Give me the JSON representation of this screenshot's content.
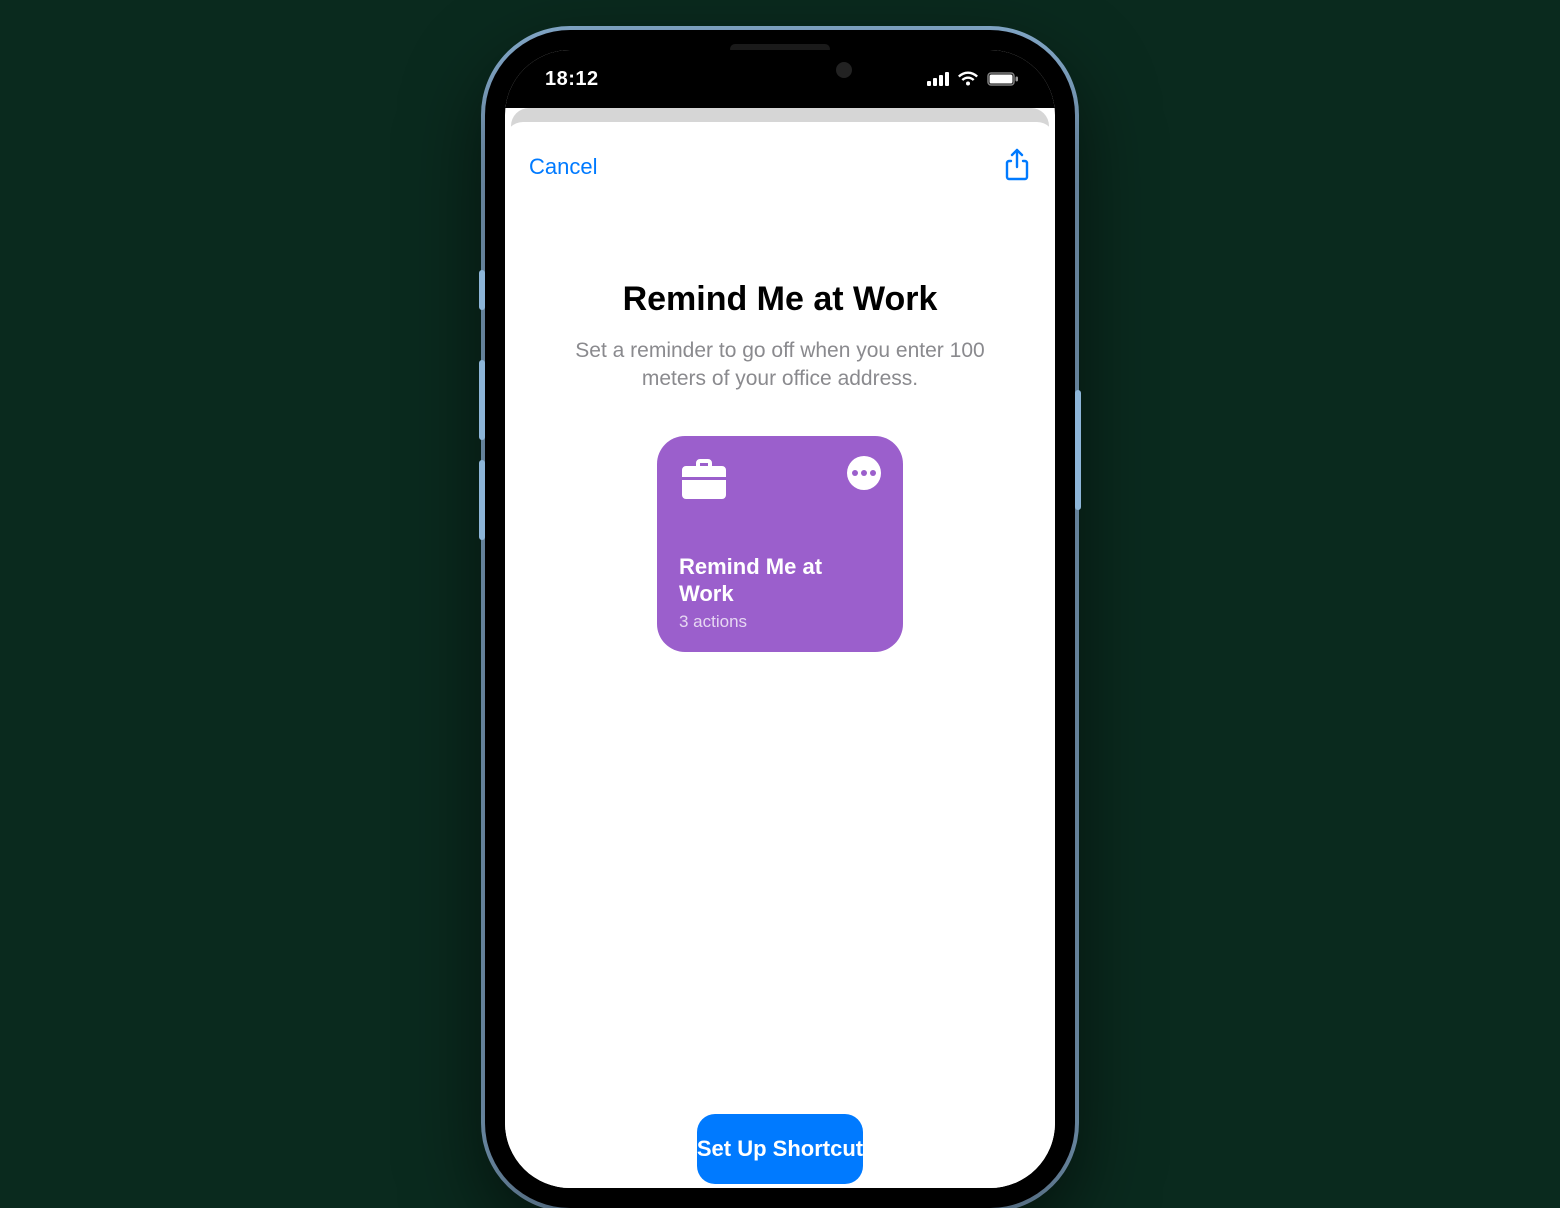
{
  "status": {
    "time": "18:12"
  },
  "nav": {
    "cancel": "Cancel"
  },
  "main": {
    "title": "Remind Me at Work",
    "description": "Set a reminder to go off when you enter 100 meters of your office address."
  },
  "card": {
    "title": "Remind Me at Work",
    "subtitle": "3 actions",
    "icon": "briefcase-icon",
    "accent_color": "#9b5fcc"
  },
  "cta": {
    "label": "Set Up Shortcut"
  },
  "colors": {
    "primary": "#007aff",
    "text_secondary": "#8a8a8e"
  }
}
